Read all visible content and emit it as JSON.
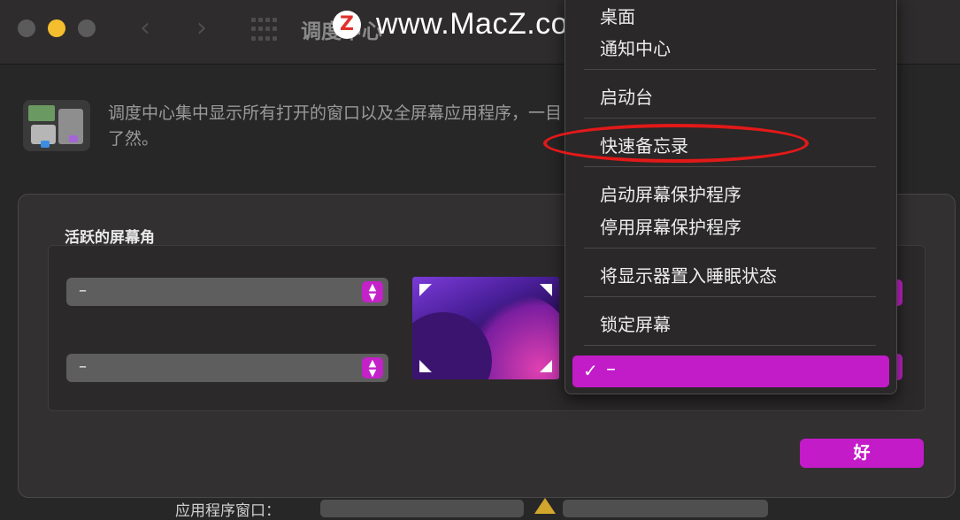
{
  "window": {
    "title": "调度中心",
    "watermark": "www.MacZ.com",
    "watermark_logo": "Z"
  },
  "intro": {
    "text": "调度中心集中显示所有打开的窗口以及全屏幕应用程序，一目了然。"
  },
  "sheet": {
    "section_label": "活跃的屏幕角",
    "top_left_value": "–",
    "bottom_left_value": "–",
    "ok_label": "好"
  },
  "menu": {
    "items": [
      "桌面",
      "通知中心",
      "启动台",
      "快速备忘录",
      "启动屏幕保护程序",
      "停用屏幕保护程序",
      "将显示器置入睡眠状态",
      "锁定屏幕"
    ],
    "selected": "–",
    "check_glyph": "✓",
    "highlighted_item": "快速备忘录"
  },
  "bottom": {
    "label": "应用程序窗口："
  },
  "colors": {
    "accent": "#c41bc9",
    "annotation": "#e21919",
    "close_button": "#5b5b5b",
    "minimize_button": "#f4be2e"
  },
  "icons": [
    "back-arrow-icon",
    "forward-arrow-icon",
    "show-all-grid-icon",
    "mission-control-icon",
    "checkmark-icon",
    "stepper-icon",
    "warning-icon"
  ]
}
